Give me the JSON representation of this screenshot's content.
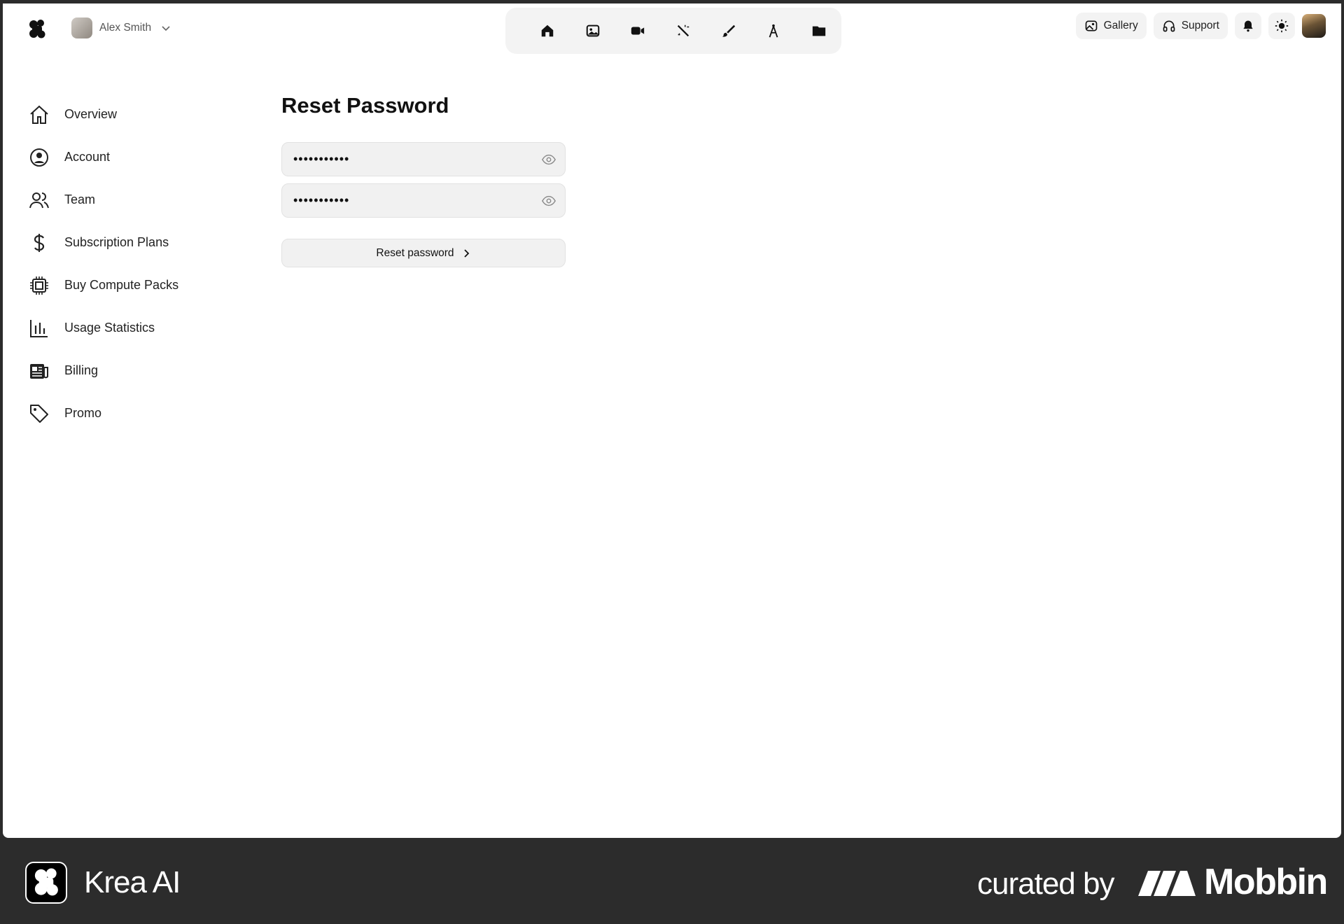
{
  "header": {
    "user_name": "Alex Smith",
    "toolbar_tools": [
      "home-icon",
      "image-icon",
      "video-icon",
      "magic-wand-icon",
      "brush-icon",
      "compass-icon",
      "folder-icon"
    ],
    "gallery_label": "Gallery",
    "support_label": "Support"
  },
  "sidebar": {
    "items": [
      {
        "label": "Overview",
        "icon": "home-icon"
      },
      {
        "label": "Account",
        "icon": "user-circle-icon"
      },
      {
        "label": "Team",
        "icon": "users-icon"
      },
      {
        "label": "Subscription Plans",
        "icon": "dollar-icon"
      },
      {
        "label": "Buy Compute Packs",
        "icon": "chip-icon"
      },
      {
        "label": "Usage Statistics",
        "icon": "bar-chart-icon"
      },
      {
        "label": "Billing",
        "icon": "newspaper-icon"
      },
      {
        "label": "Promo",
        "icon": "tag-icon"
      }
    ]
  },
  "main": {
    "title": "Reset Password",
    "password_value": "•••••••••••",
    "confirm_value": "•••••••••••",
    "submit_label": "Reset password"
  },
  "footer": {
    "app_name": "Krea AI",
    "curated_by": "curated by",
    "brand": "Mobbin"
  },
  "colors": {
    "footer_bg": "#2c2c2c",
    "control_bg": "#f1f1f1",
    "text": "#111111"
  }
}
